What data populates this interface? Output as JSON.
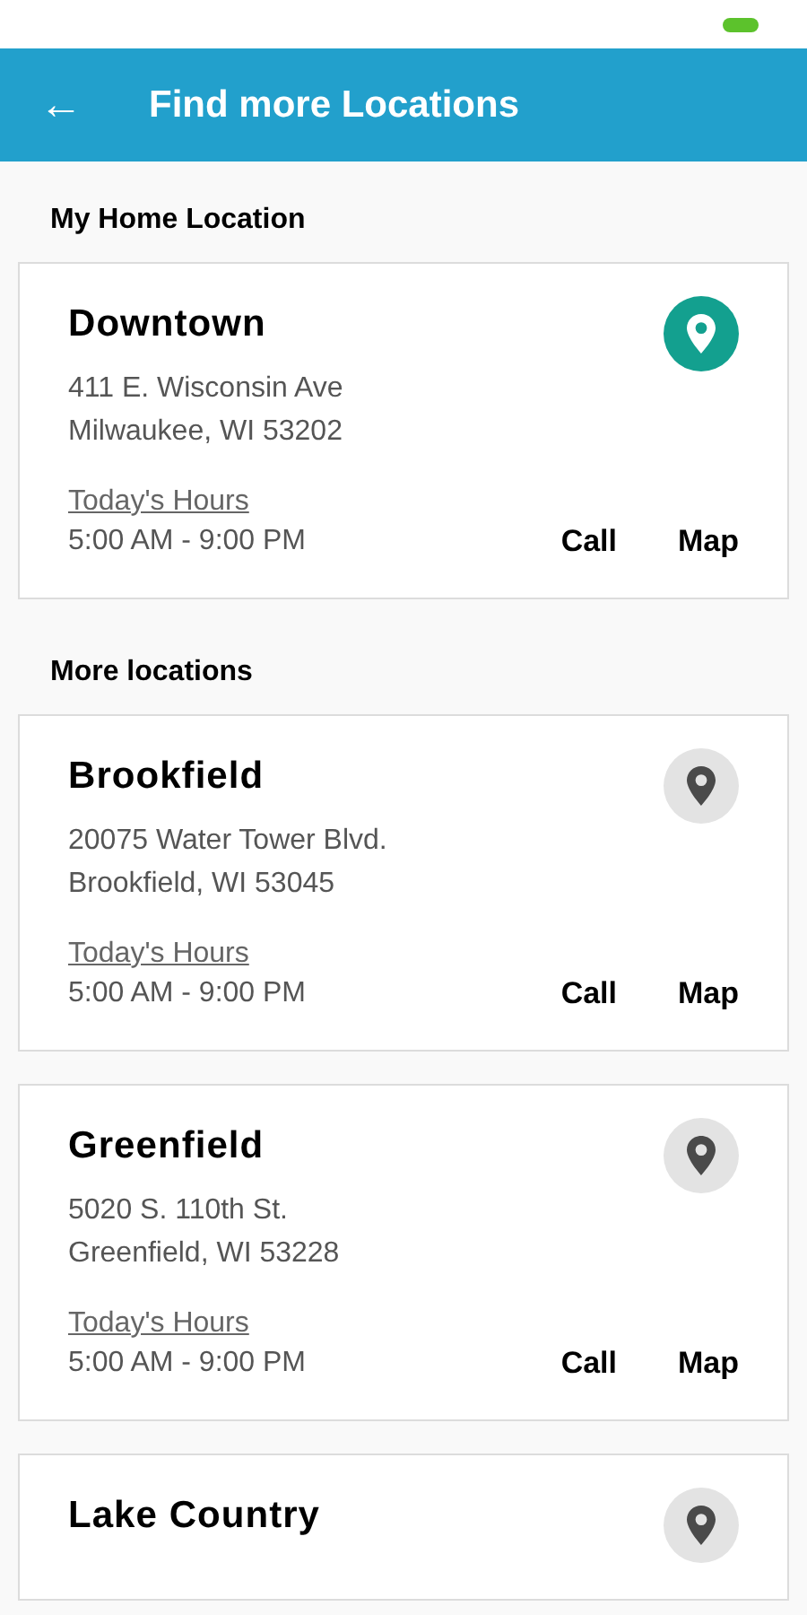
{
  "header": {
    "back_icon": "←",
    "title": "Find more Locations"
  },
  "sections": [
    {
      "title": "My Home Location",
      "locations": [
        {
          "name": "Downtown",
          "address": [
            "411 E. Wisconsin Ave",
            "Milwaukee, WI 53202"
          ],
          "hours_label": "Today's Hours",
          "hours": "5:00 AM - 9:00 PM",
          "actions": [
            "Call",
            "Map"
          ],
          "home": true
        }
      ]
    },
    {
      "title": "More locations",
      "locations": [
        {
          "name": "Brookfield",
          "address": [
            "20075 Water Tower Blvd.",
            "Brookfield, WI 53045"
          ],
          "hours_label": "Today's Hours",
          "hours": "5:00 AM - 9:00 PM",
          "actions": [
            "Call",
            "Map"
          ],
          "home": false
        },
        {
          "name": "Greenfield",
          "address": [
            "5020 S. 110th St.",
            "Greenfield, WI 53228"
          ],
          "hours_label": "Today's Hours",
          "hours": "5:00 AM - 9:00 PM",
          "actions": [
            "Call",
            "Map"
          ],
          "home": false
        },
        {
          "name": "Lake Country",
          "home": false
        }
      ]
    }
  ]
}
